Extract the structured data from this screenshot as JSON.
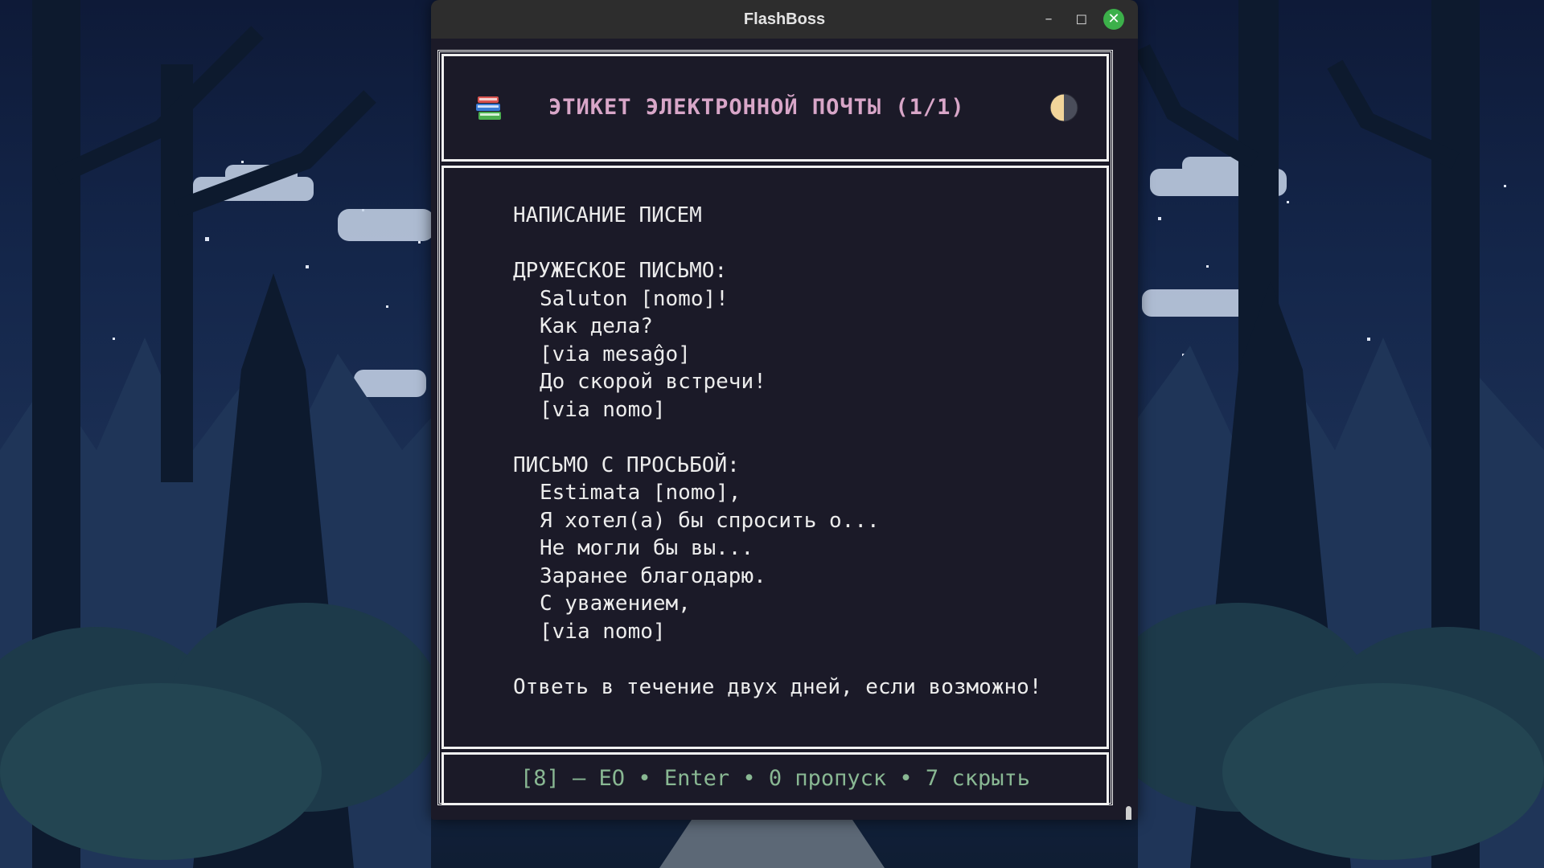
{
  "window": {
    "title": "FlashBoss",
    "minimize_label": "–",
    "maximize_label": "◻",
    "close_label": "✕"
  },
  "header": {
    "left_icon": "books-icon",
    "title": "ЭТИКЕТ ЭЛЕКТРОННОЙ ПОЧТЫ (1/1)",
    "right_icon": "moon-icon"
  },
  "card": {
    "lines": [
      {
        "text": "НАПИСАНИЕ ПИСЕМ",
        "indent": false
      },
      {
        "text": "",
        "indent": false
      },
      {
        "text": "ДРУЖЕСКОЕ ПИСЬМО:",
        "indent": false
      },
      {
        "text": "Saluton [nomo]!",
        "indent": true
      },
      {
        "text": "Как дела?",
        "indent": true
      },
      {
        "text": "[via mesaĝo]",
        "indent": true
      },
      {
        "text": "До скорой встречи!",
        "indent": true
      },
      {
        "text": "[via nomo]",
        "indent": true
      },
      {
        "text": "",
        "indent": false
      },
      {
        "text": "ПИСЬМО С ПРОСЬБОЙ:",
        "indent": false
      },
      {
        "text": "Estimata [nomo],",
        "indent": true
      },
      {
        "text": "Я хотел(а) бы спросить о...",
        "indent": true
      },
      {
        "text": "Не могли бы вы...",
        "indent": true
      },
      {
        "text": "Заранее благодарю.",
        "indent": true
      },
      {
        "text": "С уважением,",
        "indent": true
      },
      {
        "text": "[via nomo]",
        "indent": true
      },
      {
        "text": "",
        "indent": false
      },
      {
        "text": "Ответь в течение двух дней, если возможно!",
        "indent": false
      }
    ]
  },
  "footer": {
    "hint": "[8] — EO • Enter • 0 пропуск • 7 скрыть"
  },
  "colors": {
    "title_pink": "#d8a6c8",
    "hint_green": "#89b893",
    "terminal_bg": "#1b1a28",
    "close_green": "#3cb04a"
  }
}
